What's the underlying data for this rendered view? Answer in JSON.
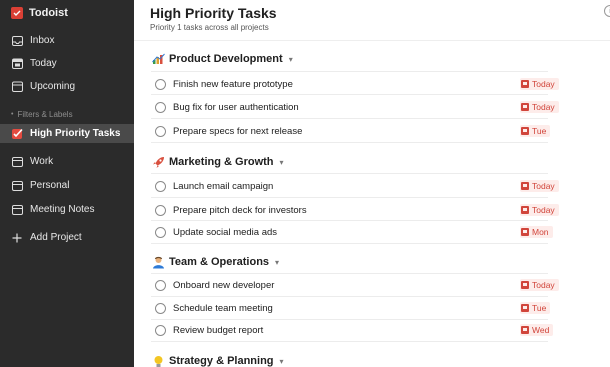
{
  "app": {
    "name": "Todoist",
    "brand_color": "#db4035"
  },
  "sidebar": {
    "nav": [
      {
        "label": "Inbox",
        "icon": "inbox-icon"
      },
      {
        "label": "Today",
        "icon": "calendar-today-icon"
      },
      {
        "label": "Upcoming",
        "icon": "calendar-upcoming-icon"
      }
    ],
    "section_label": "Filters & Labels",
    "filter": {
      "label": "High Priority Tasks",
      "icon": "filter-check-icon",
      "active": true
    },
    "projects": [
      {
        "label": "Work",
        "icon": "project-work-icon"
      },
      {
        "label": "Personal",
        "icon": "project-personal-icon"
      },
      {
        "label": "Meeting Notes",
        "icon": "project-notes-icon"
      }
    ],
    "add_project": {
      "label": "Add Project",
      "icon": "plus-icon"
    }
  },
  "main": {
    "title": "High Priority Tasks",
    "subtitle": "Priority 1 tasks across all projects",
    "corner_icon": "info-icon",
    "groups": [
      {
        "name": "Product Development",
        "icon": "chart-icon",
        "tasks": [
          {
            "title": "Finish new feature prototype",
            "due": "Today"
          },
          {
            "title": "Bug fix for user authentication",
            "due": "Today"
          },
          {
            "title": "Prepare specs for next release",
            "due": "Tue"
          }
        ]
      },
      {
        "name": "Marketing & Growth",
        "icon": "rocket-icon",
        "tasks": [
          {
            "title": "Launch email campaign",
            "due": "Today"
          },
          {
            "title": "Prepare pitch deck for investors",
            "due": "Today"
          },
          {
            "title": "Update social media ads",
            "due": "Mon"
          }
        ]
      },
      {
        "name": "Team & Operations",
        "icon": "person-icon",
        "tasks": [
          {
            "title": "Onboard new developer",
            "due": "Today"
          },
          {
            "title": "Schedule team meeting",
            "due": "Tue"
          },
          {
            "title": "Review budget report",
            "due": "Wed"
          }
        ]
      },
      {
        "name": "Strategy & Planning",
        "icon": "lightbulb-icon",
        "tasks": []
      }
    ],
    "due_color": "#d1453b"
  }
}
